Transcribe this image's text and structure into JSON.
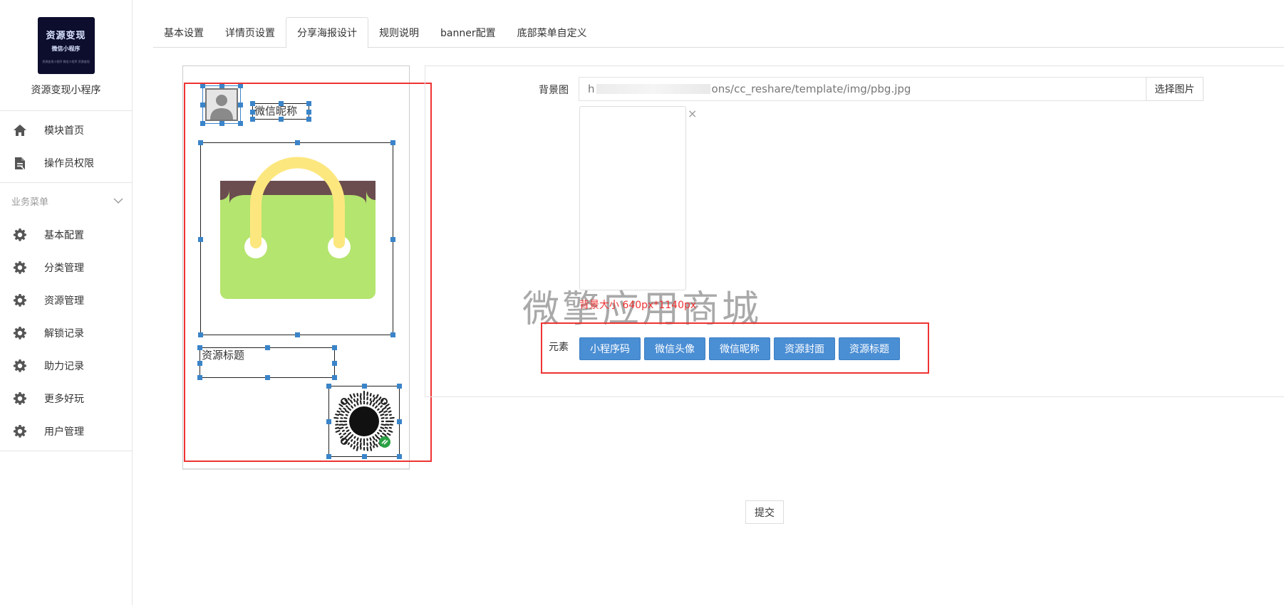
{
  "sidebar": {
    "logo": {
      "line1": "资源变现",
      "line2": "微信小程序",
      "line3": "资源变现小程序 微信小程序 资源变现"
    },
    "app_name": "资源变现小程序",
    "top_items": [
      {
        "label": "模块首页",
        "icon": "home-icon"
      },
      {
        "label": "操作员权限",
        "icon": "document-icon"
      }
    ],
    "group_title": "业务菜单",
    "group_items": [
      {
        "label": "基本配置",
        "icon": "gear-icon"
      },
      {
        "label": "分类管理",
        "icon": "gear-icon"
      },
      {
        "label": "资源管理",
        "icon": "gear-icon"
      },
      {
        "label": "解锁记录",
        "icon": "gear-icon"
      },
      {
        "label": "助力记录",
        "icon": "gear-icon"
      },
      {
        "label": "更多好玩",
        "icon": "gear-icon"
      },
      {
        "label": "用户管理",
        "icon": "gear-icon"
      }
    ]
  },
  "tabs": [
    {
      "label": "基本设置",
      "active": false
    },
    {
      "label": "详情页设置",
      "active": false
    },
    {
      "label": "分享海报设计",
      "active": true
    },
    {
      "label": "规则说明",
      "active": false
    },
    {
      "label": "banner配置",
      "active": false
    },
    {
      "label": "底部菜单自定义",
      "active": false
    }
  ],
  "poster": {
    "nickname_text": "微信昵称",
    "title_text": "资源标题"
  },
  "form": {
    "bg_label": "背景图",
    "bg_url_prefix": "h",
    "bg_url_suffix": "ons/cc_reshare/template/img/pbg.jpg",
    "pick_button": "选择图片",
    "remove_glyph": "×",
    "size_hint": "背景大小 640px*1140px",
    "elements_label": "元素",
    "element_buttons": [
      "小程序码",
      "微信头像",
      "微信昵称",
      "资源封面",
      "资源标题"
    ],
    "submit": "提交"
  },
  "watermark": "微擎应用商城",
  "colors": {
    "primary": "#4a8ed4",
    "highlight_red": "#e33333",
    "handle_blue": "#3a84c9"
  }
}
